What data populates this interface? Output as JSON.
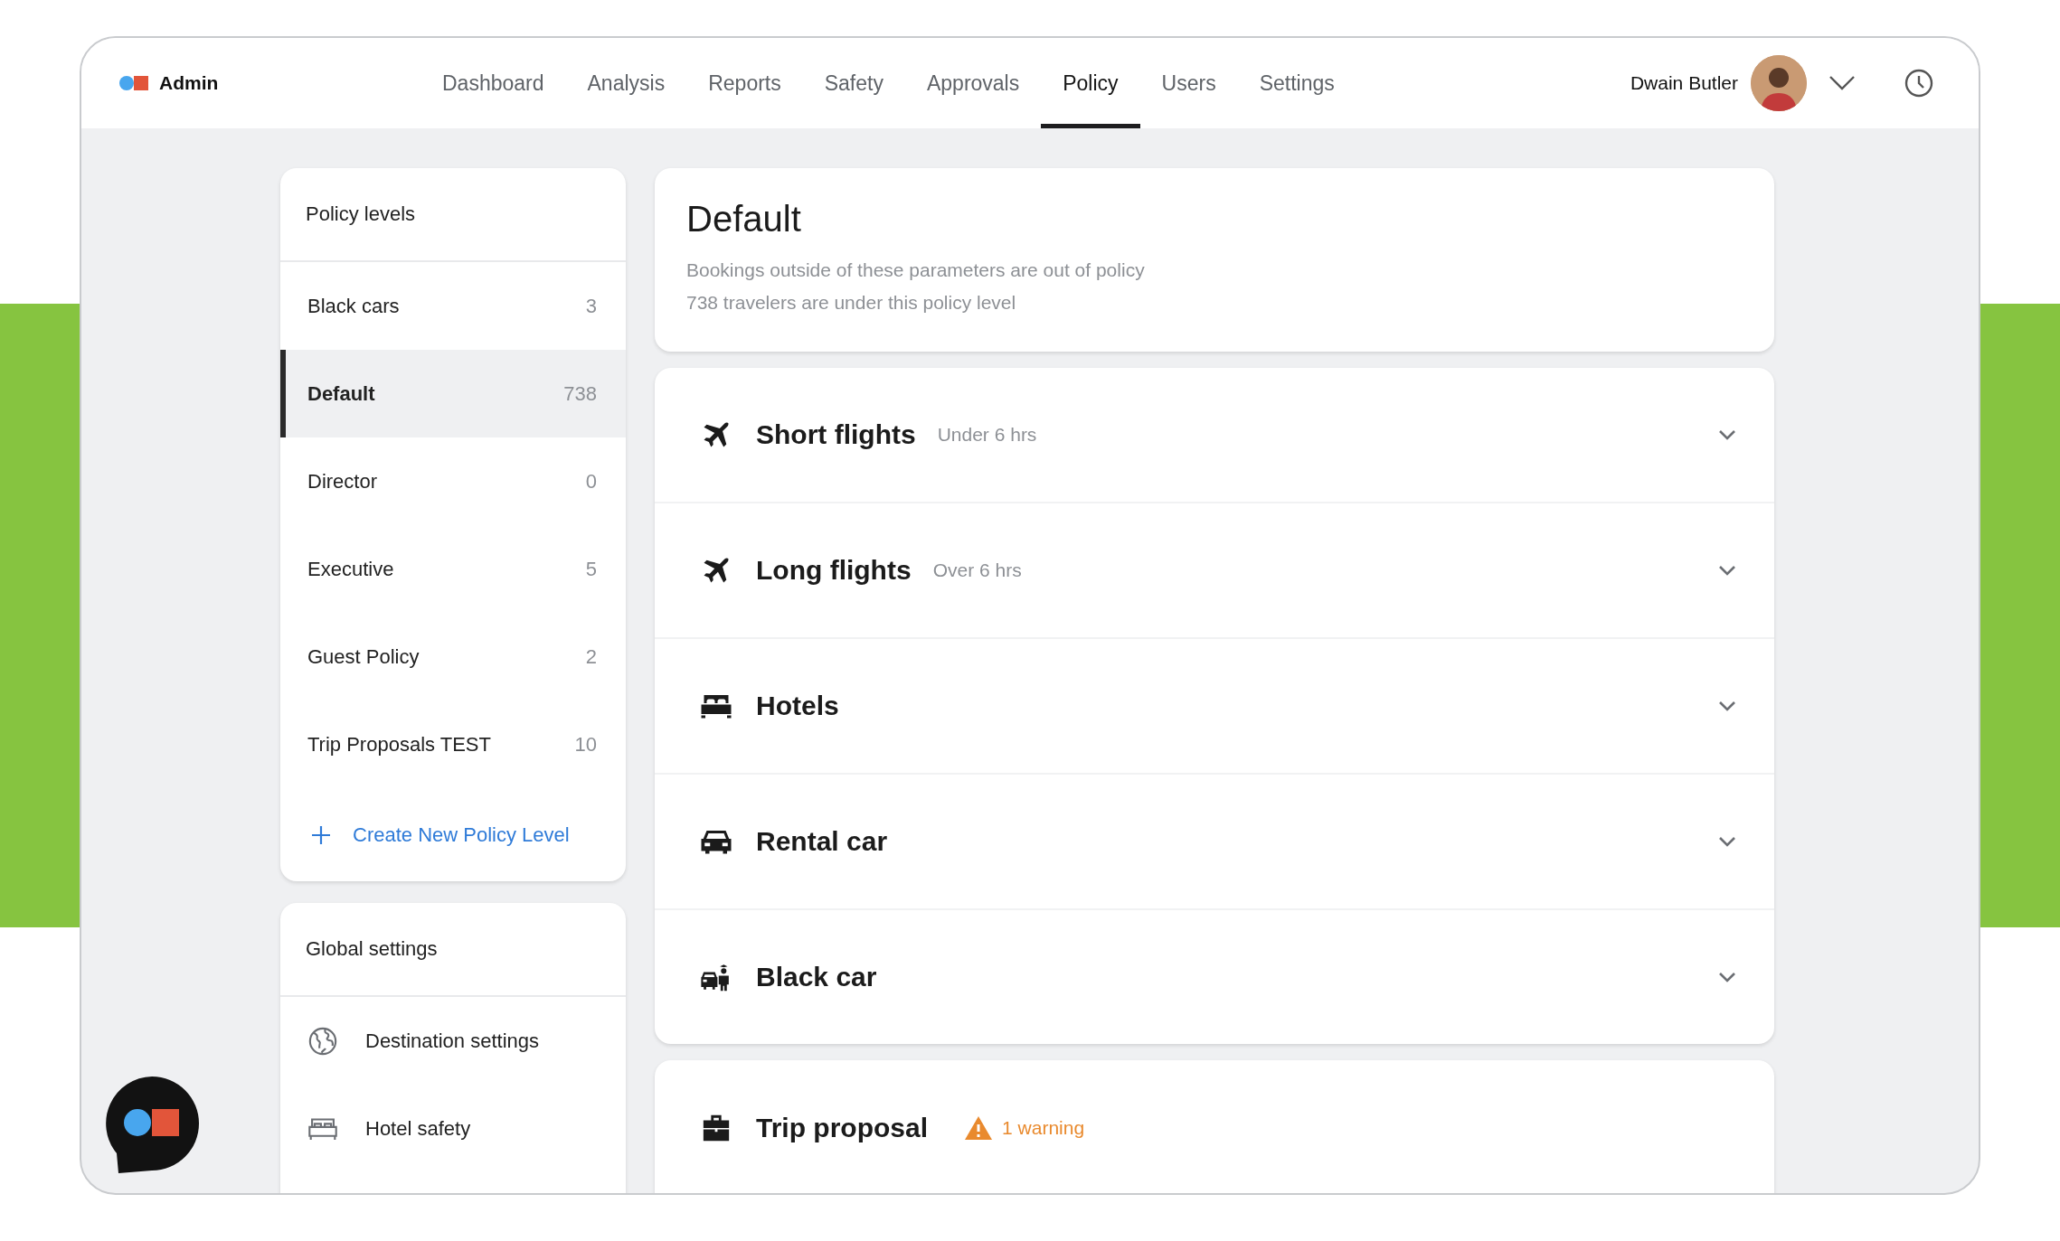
{
  "brand": {
    "name": "Admin"
  },
  "nav": [
    {
      "label": "Dashboard",
      "selected": false
    },
    {
      "label": "Analysis",
      "selected": false
    },
    {
      "label": "Reports",
      "selected": false
    },
    {
      "label": "Safety",
      "selected": false
    },
    {
      "label": "Approvals",
      "selected": false
    },
    {
      "label": "Policy",
      "selected": true
    },
    {
      "label": "Users",
      "selected": false
    },
    {
      "label": "Settings",
      "selected": false
    }
  ],
  "user": {
    "name": "Dwain Butler"
  },
  "policy_levels": {
    "title": "Policy levels",
    "items": [
      {
        "name": "Black cars",
        "count": "3",
        "selected": false
      },
      {
        "name": "Default",
        "count": "738",
        "selected": true
      },
      {
        "name": "Director",
        "count": "0",
        "selected": false
      },
      {
        "name": "Executive",
        "count": "5",
        "selected": false
      },
      {
        "name": "Guest Policy",
        "count": "2",
        "selected": false
      },
      {
        "name": "Trip Proposals TEST",
        "count": "10",
        "selected": false
      }
    ],
    "create_label": "Create New Policy Level"
  },
  "global_settings": {
    "title": "Global settings",
    "items": [
      {
        "label": "Destination settings",
        "kind": "destination"
      },
      {
        "label": "Hotel safety",
        "kind": "hotel"
      }
    ]
  },
  "policy": {
    "title": "Default",
    "description": "Bookings outside of these parameters are out of policy",
    "travelers": "738 travelers are under this policy level"
  },
  "categories": [
    {
      "kind": "flight",
      "title": "Short flights",
      "subtitle": "Under 6 hrs",
      "expanded": false
    },
    {
      "kind": "flight",
      "title": "Long flights",
      "subtitle": "Over 6 hrs",
      "expanded": false
    },
    {
      "kind": "hotel",
      "title": "Hotels",
      "expanded": false
    },
    {
      "kind": "rental",
      "title": "Rental car",
      "expanded": false
    },
    {
      "kind": "chauffeur",
      "title": "Black car",
      "expanded": false
    }
  ],
  "trip_proposal": {
    "title": "Trip proposal",
    "warning": "1 warning"
  }
}
